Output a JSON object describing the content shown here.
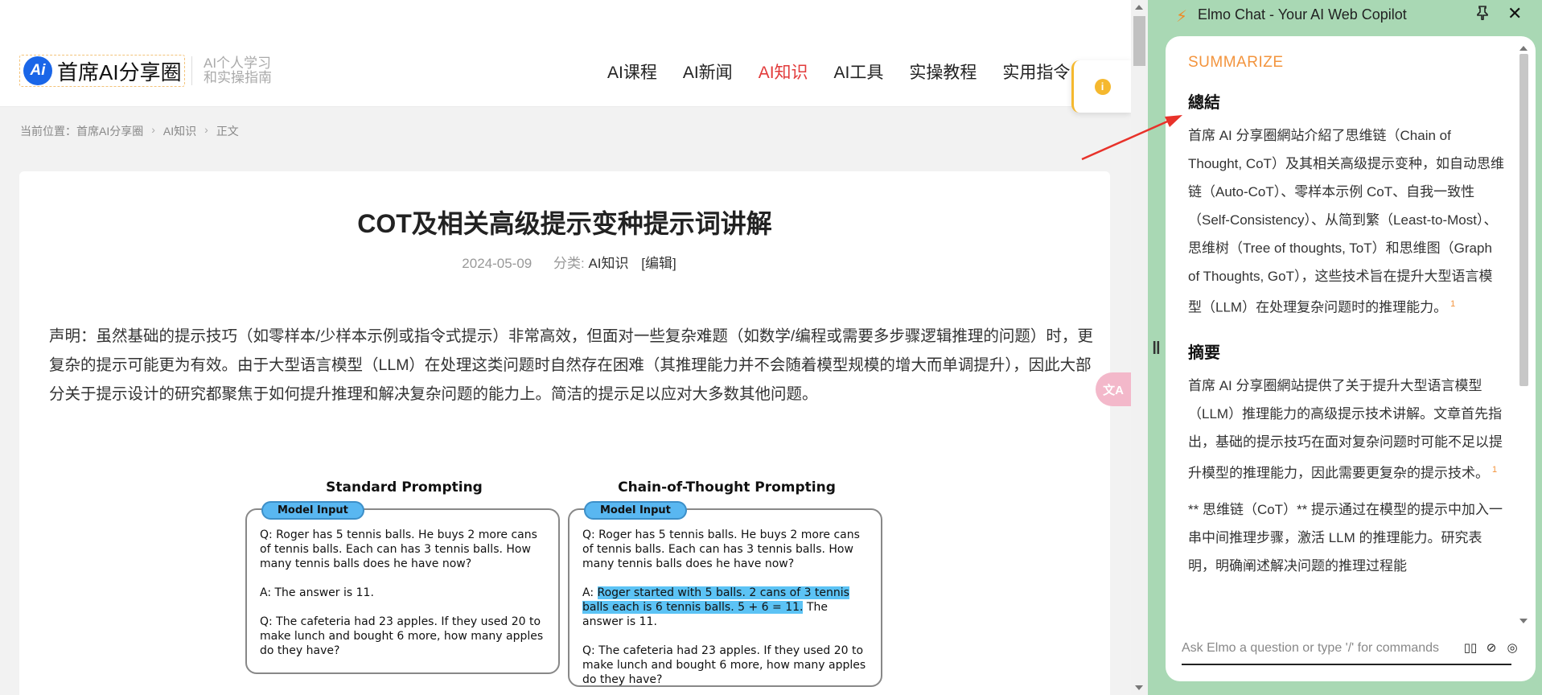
{
  "site": {
    "logo_badge": "Ai",
    "logo_text": "首席AI分享圈",
    "logo_sub_1": "AI个人学习",
    "logo_sub_2": "和实操指南",
    "nav": [
      "AI课程",
      "AI新闻",
      "AI知识",
      "AI工具",
      "实操教程",
      "实用指令"
    ],
    "active_nav": "AI知识"
  },
  "breadcrumb": {
    "prefix": "当前位置：",
    "items": [
      "首席AI分享圈",
      "AI知识",
      "正文"
    ],
    "separator": "›"
  },
  "article": {
    "title": "COT及相关高级提示变种提示词讲解",
    "date": "2024-05-09",
    "category_label": "分类:",
    "category": "AI知识",
    "edit": "[编辑]",
    "paragraph": "声明：虽然基础的提示技巧（如零样本/少样本示例或指令式提示）非常高效，但面对一些复杂难题（如数学/编程或需要多步骤逻辑推理的问题）时，更复杂的提示可能更为有效。由于大型语言模型（LLM）在处理这类问题时自然存在困难（其推理能力并不会随着模型规模的增大而单调提升），因此大部分关于提示设计的研究都聚焦于如何提升推理和解决复杂问题的能力上。简洁的提示足以应对大多数其他问题。"
  },
  "figure": {
    "left_heading": "Standard Prompting",
    "right_heading": "Chain-of-Thought Prompting",
    "pill": "Model Input",
    "q1": "Q: Roger has 5 tennis balls. He buys 2 more cans of tennis balls. Each can has 3 tennis balls. How many tennis balls does he have now?",
    "a_standard": "A: The answer is 11.",
    "a_cot_prefix": "A: ",
    "a_cot_highlight": "Roger started with 5 balls. 2 cans of 3 tennis balls each is 6 tennis balls. 5 + 6 = 11.",
    "a_cot_suffix": " The answer is 11.",
    "q2": "Q: The cafeteria had 23 apples. If they used 20 to make lunch and bought 6 more, how many apples do they have?",
    "highlight_color": "#5cc3f5"
  },
  "panel": {
    "title": "Elmo Chat - Your AI Web Copilot",
    "summarize": "SUMMARIZE",
    "section1_title": "總結",
    "section1_text": "首席 AI 分享圈網站介紹了思维链（Chain of Thought, CoT）及其相关高级提示变种，如自动思维链（Auto-CoT）、零样本示例 CoT、自我一致性（Self-Consistency）、从简到繁（Least-to-Most）、思维树（Tree of thoughts, ToT）和思维图（Graph of Thoughts, GoT），这些技术旨在提升大型语言模型（LLM）在处理复杂问题时的推理能力。",
    "section2_title": "摘要",
    "section2_text": "首席 AI 分享圈網站提供了关于提升大型语言模型（LLM）推理能力的高级提示技术讲解。文章首先指出，基础的提示技巧在面对复杂问题时可能不足以提升模型的推理能力，因此需要更复杂的提示技术。",
    "section3_text": "** 思维链（CoT）** 提示通过在模型的提示中加入一串中间推理步骤，激活 LLM 的推理能力。研究表明，明确阐述解决问题的推理过程能",
    "cite": "1",
    "ask_placeholder": "Ask Elmo a question or type '/' for commands",
    "accent_color": "#f3943d",
    "panel_bg": "#a9d8b4"
  }
}
